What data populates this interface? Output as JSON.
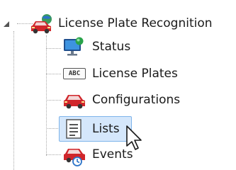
{
  "tree": {
    "root": {
      "label": "License Plate Recognition",
      "expander_icon": "collapse-triangle-icon",
      "icon": "car-globe-icon"
    },
    "children": [
      {
        "label": "Status",
        "icon": "monitor-status-icon"
      },
      {
        "label": "License Plates",
        "icon": "abc-plate-icon",
        "plate_text": "ABC"
      },
      {
        "label": "Configurations",
        "icon": "car-icon"
      },
      {
        "label": "Lists",
        "icon": "list-document-icon",
        "selected": true
      },
      {
        "label": "Events",
        "icon": "car-events-icon"
      }
    ]
  },
  "colors": {
    "car_red": "#d0262b",
    "selection_bg": "#d5e7fb",
    "selection_border": "#7eb4ea",
    "tree_line": "#a8a8a8"
  }
}
